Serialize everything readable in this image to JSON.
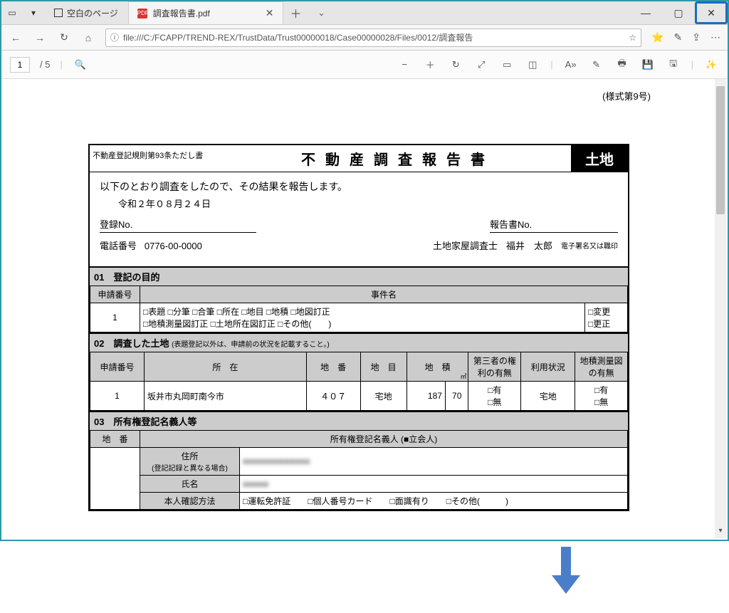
{
  "window": {
    "tab_inactive_label": "空白のページ",
    "tab_active_label": "調査報告書.pdf"
  },
  "address_bar": {
    "url": "file:///C:/FCAPP/TREND-REX/TrustData/Trust00000018/Case00000028/Files/0012/調査報告"
  },
  "pdf_toolbar": {
    "page_current": "1",
    "page_total": "/ 5"
  },
  "document": {
    "form_note": "(様式第9号)",
    "header_left": "不動産登記規則第93条ただし書",
    "header_title": "不動産調査報告書",
    "header_land": "土地",
    "intro": "以下のとおり調査をしたので、その結果を報告します。",
    "date": "令和２年０８月２４日",
    "reg_no_label": "登録No.",
    "report_no_label": "報告書No.",
    "tel_label": "電話番号",
    "tel_value": "0776-00-0000",
    "surveyor_role": "土地家屋調査士",
    "surveyor_name": "福井　太郎",
    "sig_note": "電子署名又は職印",
    "sec01_title": "01　登記の目的",
    "sec01_app_no_hdr": "申請番号",
    "sec01_matter_hdr": "事件名",
    "sec01_app_no": "1",
    "sec01_checks": "□表題 □分筆 □合筆 □所在 □地目 □地積 □地図訂正\n□地積測量図訂正 □土地所在図訂正 □その他(　　)",
    "sec01_change": "□変更",
    "sec01_correct": "□更正",
    "sec02_title": "02　調査した土地",
    "sec02_subtitle": "(表題登記以外は、申請前の状況を記載すること。)",
    "sec02_hdrs": {
      "app_no": "申請番号",
      "location": "所　在",
      "lot_no": "地　番",
      "land_cat": "地　目",
      "area": "地　積",
      "area_unit": "㎡",
      "third_party": "第三者の権利の有無",
      "usage": "利用状況",
      "survey_map": "地積測量図の有無"
    },
    "sec02_row": {
      "app_no": "1",
      "location": "坂井市丸岡町南今市",
      "lot_no": "４０７",
      "land_cat": "宅地",
      "area_int": "187",
      "area_dec": "70",
      "third_party": "□有\n□無",
      "usage": "宅地",
      "survey_map": "□有\n□無"
    },
    "sec03_title": "03　所有権登記名義人等",
    "sec03_lot_hdr": "地　番",
    "sec03_owner_hdr": "所有権登記名義人 (■立会人)",
    "sec03_addr_label": "住所",
    "sec03_addr_note": "(登記記録と異なる場合)",
    "sec03_name_label": "氏名",
    "sec03_id_label": "本人確認方法",
    "sec03_id_opts": "□運転免許証　　□個人番号カード　　□面識有り　　□その他(　　　)"
  }
}
